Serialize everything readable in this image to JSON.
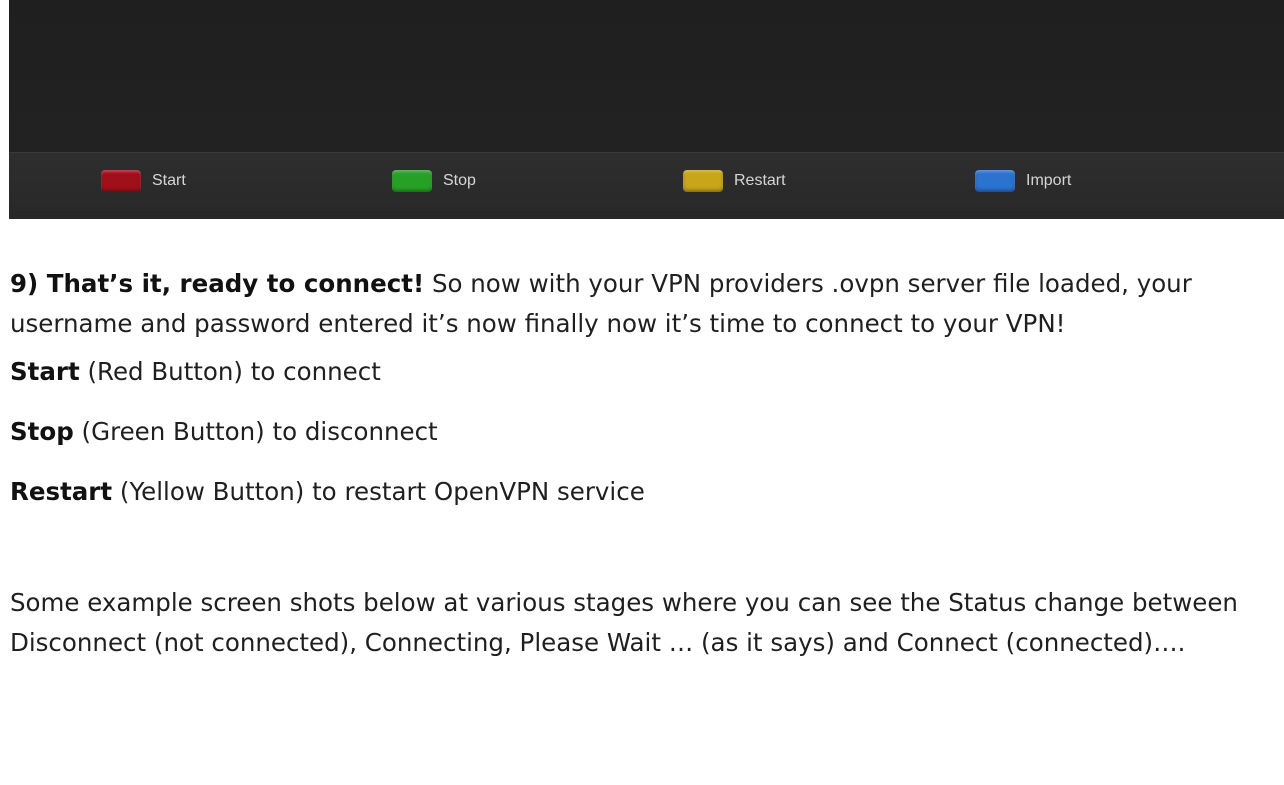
{
  "tv_ui": {
    "buttons": [
      {
        "label": "Start",
        "color": "#a0101a"
      },
      {
        "label": "Stop",
        "color": "#27a125"
      },
      {
        "label": "Restart",
        "color": "#c9a51a"
      },
      {
        "label": "Import",
        "color": "#2a73cf"
      }
    ]
  },
  "article": {
    "step_heading": "9) That’s it, ready to connect!",
    "step_body": " So now with your VPN providers .ovpn server file loaded, your username and password entered it’s now finally now it’s time to connect to your VPN!",
    "items": [
      {
        "term": "Start",
        "desc": " (Red Button) to connect"
      },
      {
        "term": "Stop",
        "desc": " (Green Button) to disconnect"
      },
      {
        "term": "Restart",
        "desc": " (Yellow Button) to restart OpenVPN service"
      }
    ],
    "closing": "Some example screen shots below at various stages where you can see the Status change between Disconnect (not connected), Connecting, Please Wait … (as it says) and Connect (connected)…."
  }
}
